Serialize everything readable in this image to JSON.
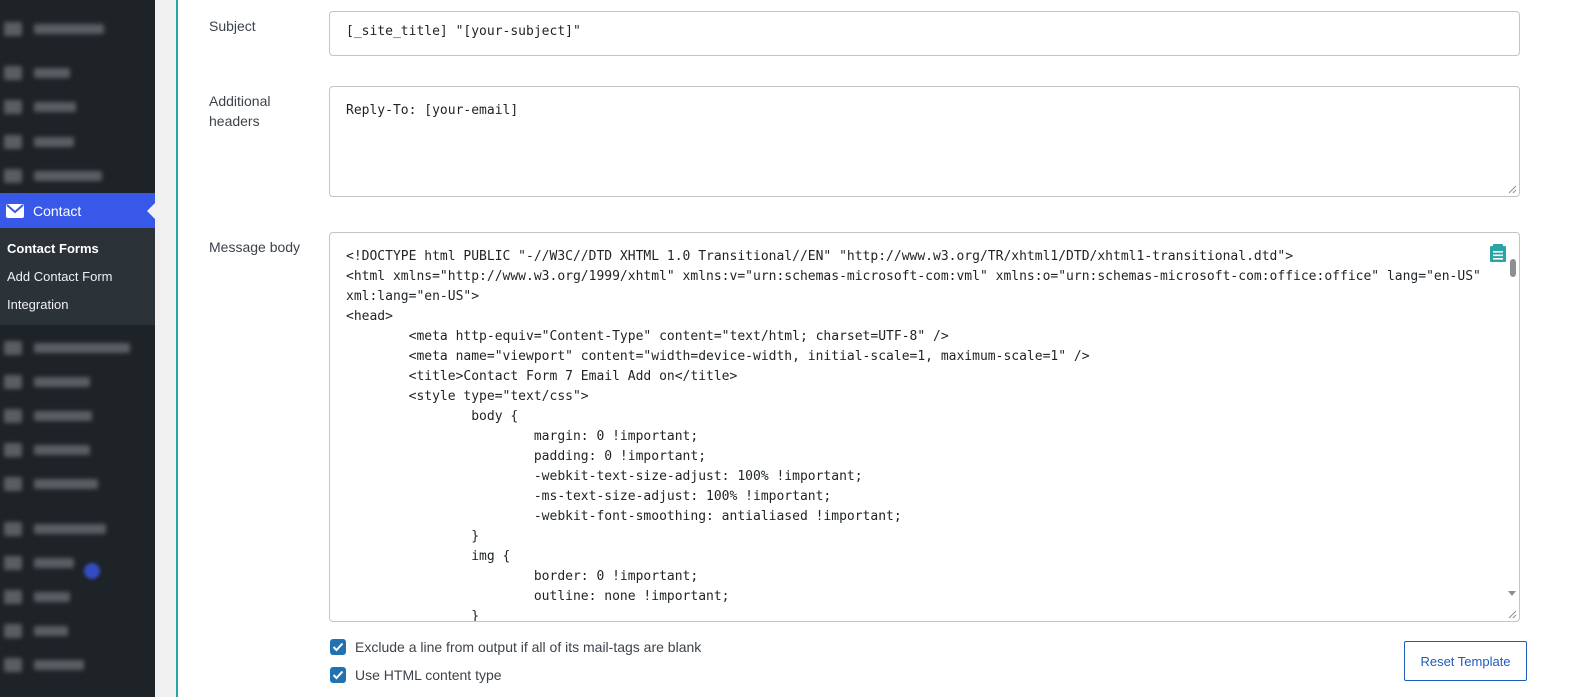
{
  "sidebar": {
    "active_menu": "Contact",
    "submenu": [
      "Contact Forms",
      "Add Contact Form",
      "Integration"
    ]
  },
  "form": {
    "subject": {
      "label": "Subject",
      "value": "[_site_title] \"[your-subject]\""
    },
    "additional_headers": {
      "label": "Additional headers",
      "value": "Reply-To: [your-email]"
    },
    "message_body": {
      "label": "Message body",
      "code": "<!DOCTYPE html PUBLIC \"-//W3C//DTD XHTML 1.0 Transitional//EN\" \"http://www.w3.org/TR/xhtml1/DTD/xhtml1-transitional.dtd\">\n<html xmlns=\"http://www.w3.org/1999/xhtml\" xmlns:v=\"urn:schemas-microsoft-com:vml\" xmlns:o=\"urn:schemas-microsoft-com:office:office\" lang=\"en-US\"\nxml:lang=\"en-US\">\n<head>\n        <meta http-equiv=\"Content-Type\" content=\"text/html; charset=UTF-8\" />\n        <meta name=\"viewport\" content=\"width=device-width, initial-scale=1, maximum-scale=1\" />\n        <title>Contact Form 7 Email Add on</title>\n        <style type=\"text/css\">\n                body {\n                        margin: 0 !important;\n                        padding: 0 !important;\n                        -webkit-text-size-adjust: 100% !important;\n                        -ms-text-size-adjust: 100% !important;\n                        -webkit-font-smoothing: antialiased !important;\n                }\n                img {\n                        border: 0 !important;\n                        outline: none !important;\n                }"
    },
    "exclude_blank_label": "Exclude a line from output if all of its mail-tags are blank",
    "html_content_label": "Use HTML content type",
    "reset_button": "Reset Template"
  },
  "colors": {
    "sidebar_bg": "#1d2327",
    "active_menu": "#3858e9",
    "panel_border": "#2aa5a5",
    "checkbox": "#2271b1",
    "button_text": "#1e5bbd"
  },
  "icons": [
    "mail-icon",
    "template-icon"
  ]
}
